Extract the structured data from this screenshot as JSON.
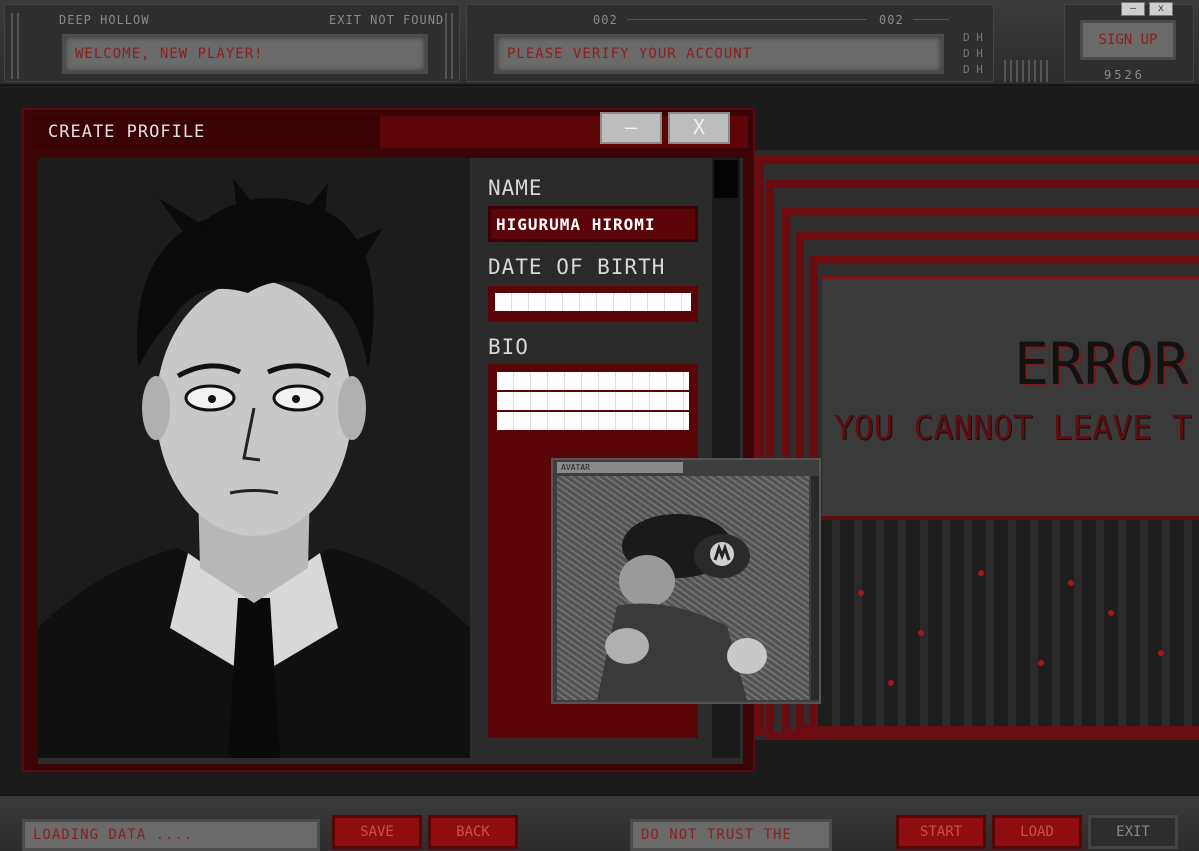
{
  "top": {
    "panel1_left": "DEEP HOLLOW",
    "panel1_right": "EXIT NOT FOUND",
    "panel1_field": "WELCOME, NEW PLAYER!",
    "panel2_left": "002",
    "panel2_right": "002",
    "panel2_field": "PLEASE VERIFY YOUR ACCOUNT",
    "dh": [
      "D H",
      "D H",
      "D H"
    ],
    "signup": "SIGN UP",
    "code": "9526",
    "minimize": "—",
    "close": "x"
  },
  "profile": {
    "title": "CREATE PROFILE",
    "minimize": "—",
    "close": "X",
    "name_label": "NAME",
    "name_value": "HIGURUMA HIROMI",
    "dob_label": "DATE OF BIRTH",
    "bio_label": "BIO"
  },
  "avatar": {
    "label": "AVATAR"
  },
  "error": {
    "title": "ERROR",
    "message": "YOU CANNOT LEAVE T"
  },
  "bottom": {
    "loading": "LOADING DATA ....",
    "save": "SAVE",
    "back": "BACK",
    "warning": "DO NOT TRUST THE ....",
    "start": "START",
    "load": "LOAD",
    "exit": "EXIT"
  },
  "colors": {
    "accent_red": "#8e0d10",
    "dark_red": "#3b0508",
    "panel_gray": "#6a6a6a"
  }
}
